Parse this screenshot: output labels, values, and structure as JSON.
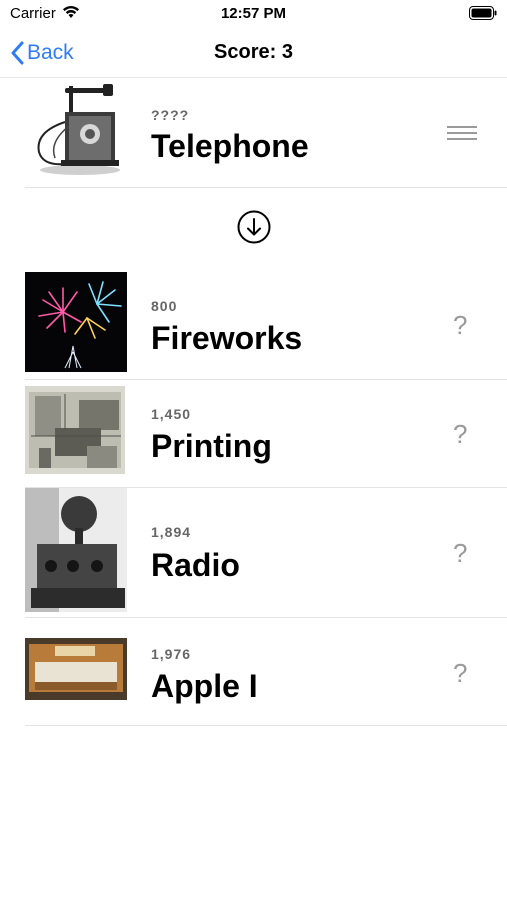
{
  "status": {
    "carrier": "Carrier",
    "time": "12:57 PM"
  },
  "nav": {
    "back_label": "Back",
    "title": "Score: 3"
  },
  "current_card": {
    "year": "????",
    "name": "Telephone",
    "image": "telephone"
  },
  "drop_hint_icon": "arrow-down-circle-icon",
  "timeline": [
    {
      "year": "800",
      "name": "Fireworks",
      "indicator": "?",
      "image": "fireworks"
    },
    {
      "year": "1,450",
      "name": "Printing",
      "indicator": "?",
      "image": "printing"
    },
    {
      "year": "1,894",
      "name": "Radio",
      "indicator": "?",
      "image": "radio"
    },
    {
      "year": "1,976",
      "name": "Apple I",
      "indicator": "?",
      "image": "apple-i"
    }
  ],
  "colors": {
    "accent": "#2f7cf6",
    "separator": "#e4e4e4",
    "muted": "#666666"
  }
}
